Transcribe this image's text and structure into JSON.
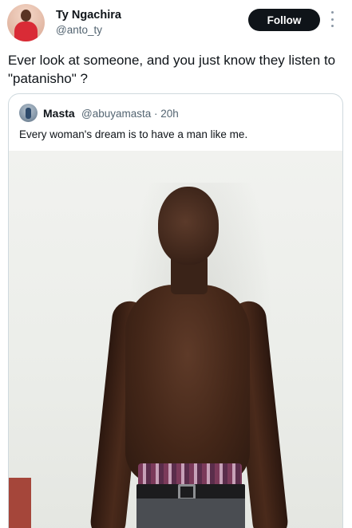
{
  "author": {
    "name": "Ty Ngachira",
    "handle": "@anto_ty"
  },
  "actions": {
    "follow_label": "Follow",
    "more_icon": "more-vertical-icon"
  },
  "tweet": {
    "text": "Ever look at someone, and you just know they listen to \"patanisho\" ?"
  },
  "quoted_tweet": {
    "name": "Masta",
    "handle": "@abuyamasta",
    "time": "· 20h",
    "text": "Every woman's dream is to have a man like me."
  },
  "colors": {
    "text_primary": "#0f1419",
    "text_secondary": "#536471",
    "follow_bg": "#0f1419",
    "border": "#cfd9de"
  }
}
